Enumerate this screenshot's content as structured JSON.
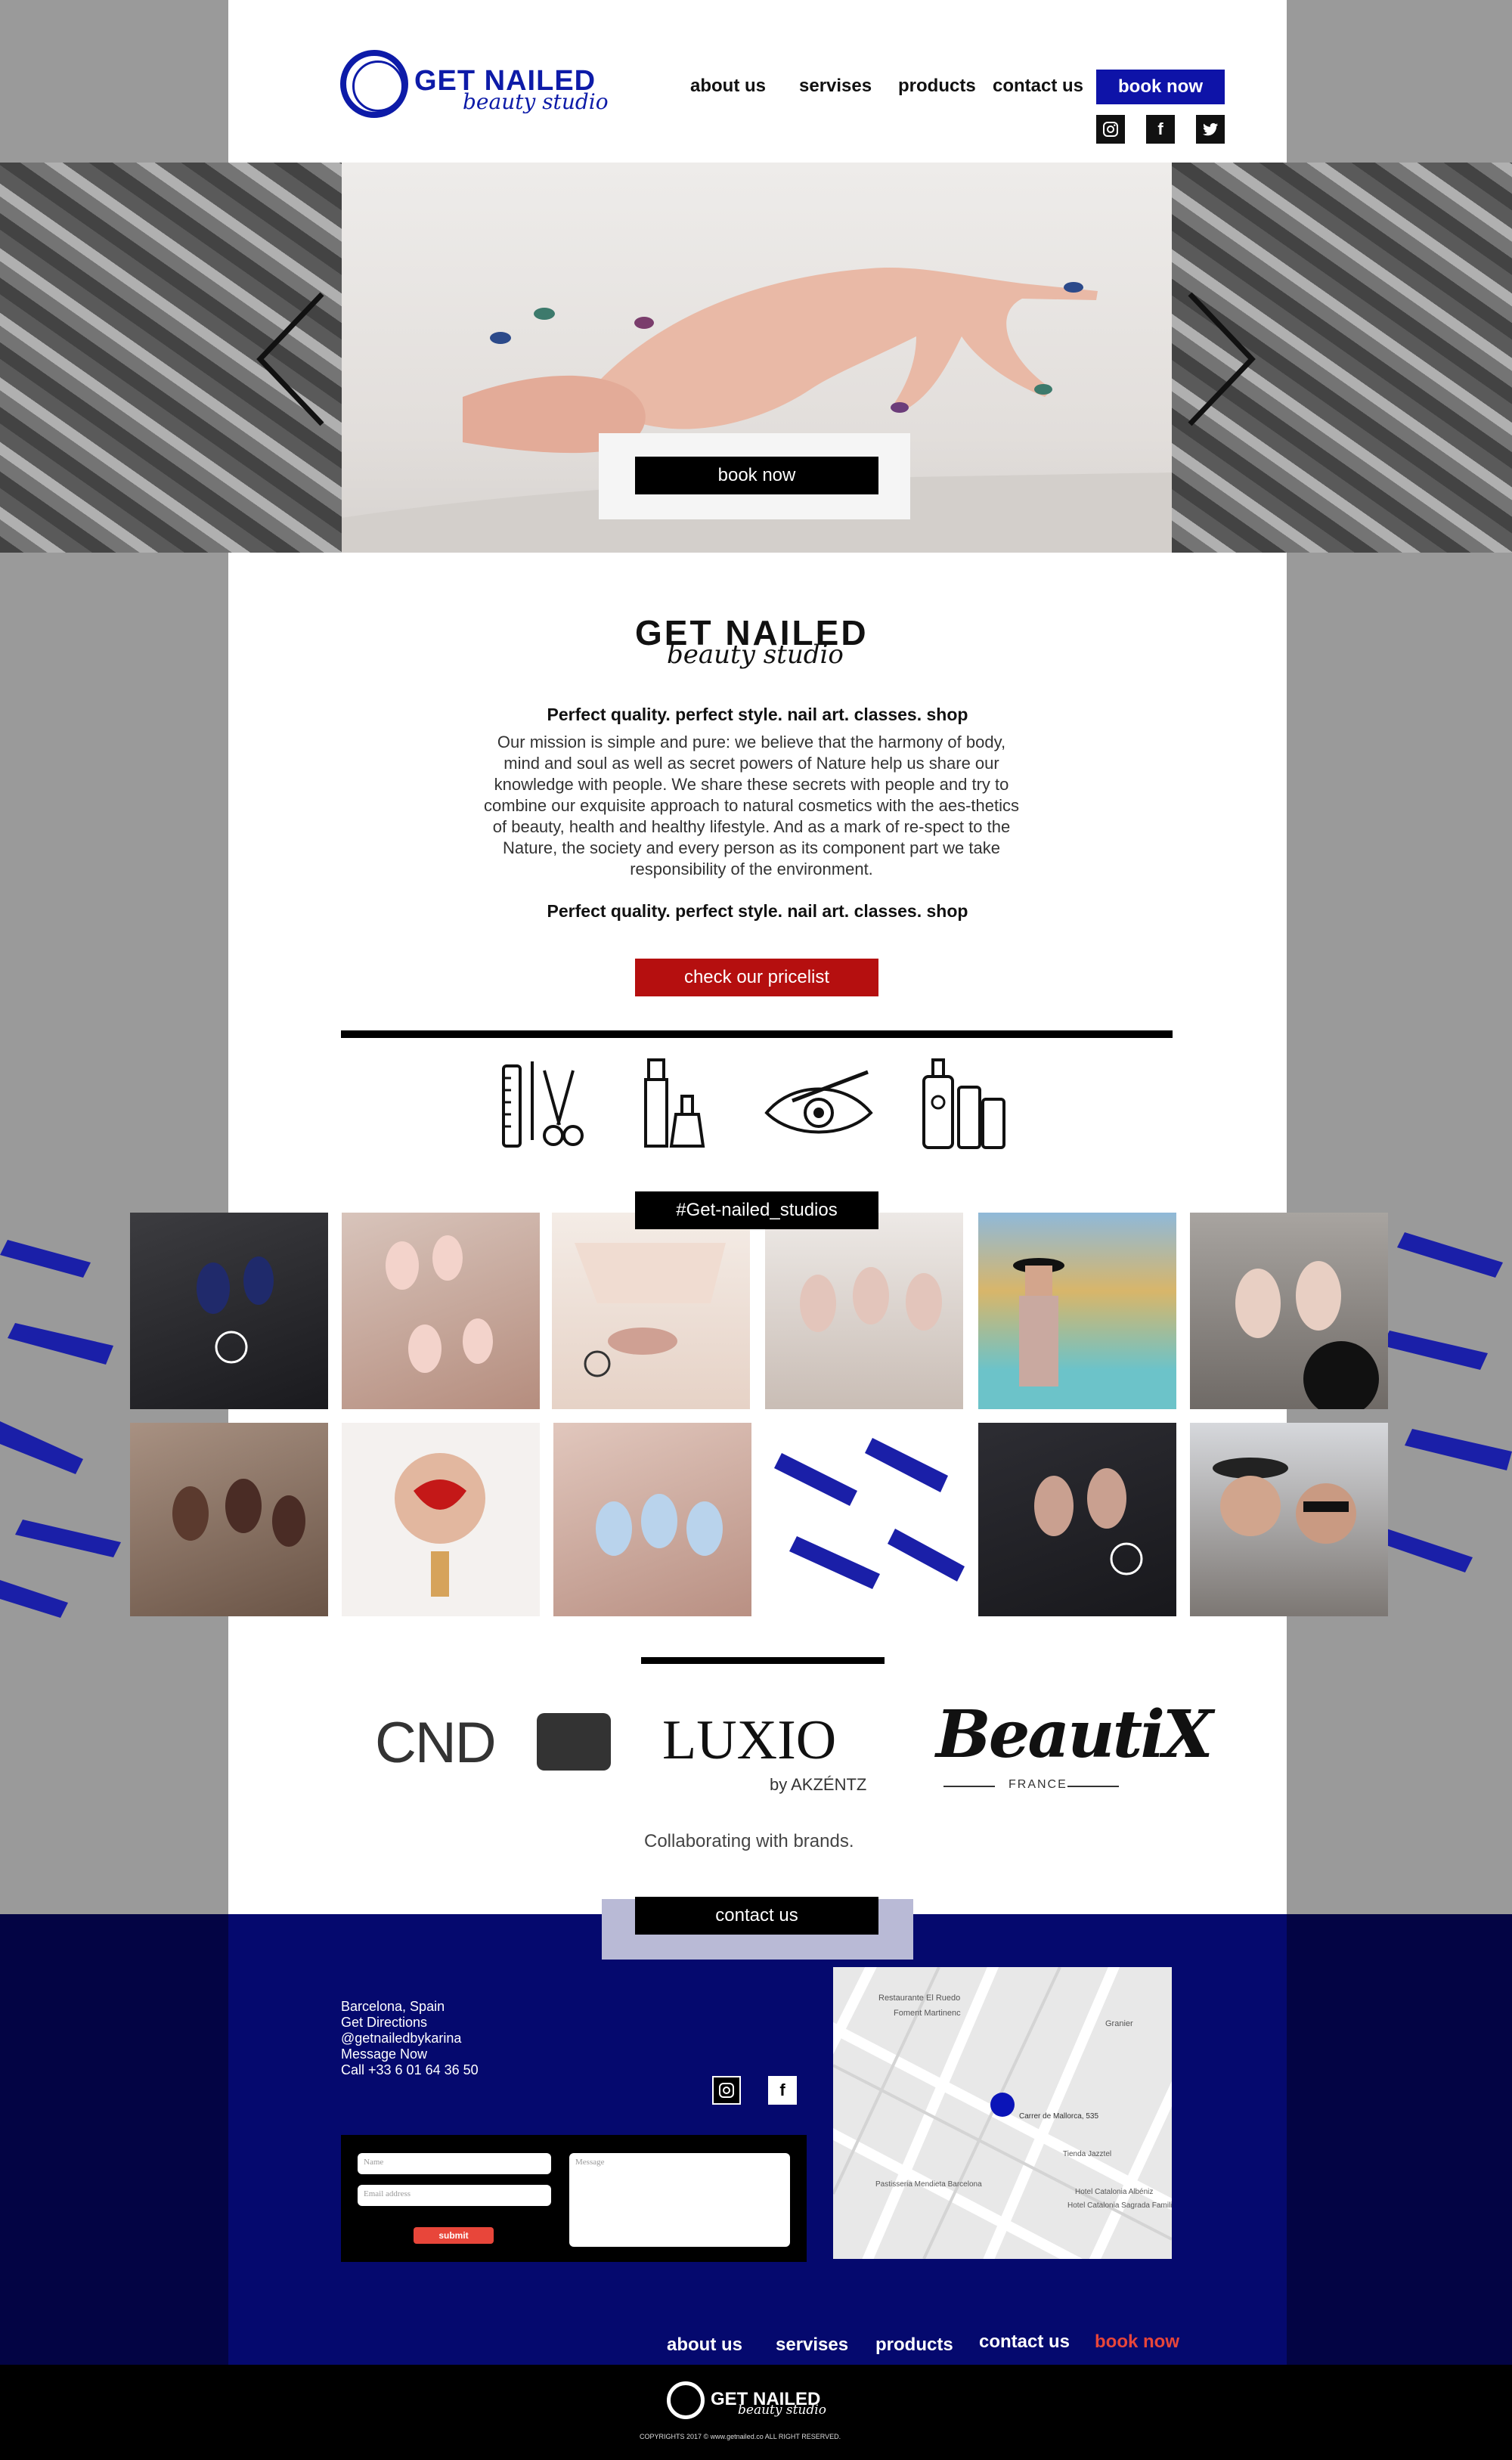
{
  "brand": {
    "name": "GET NAILED",
    "tagline": "beauty studio"
  },
  "nav": {
    "about": "about us",
    "services": "servises",
    "products": "products",
    "contact": "contact us",
    "book": "book now"
  },
  "social": {
    "instagram": "instagram-icon",
    "facebook": "f",
    "twitter": "twitter-icon"
  },
  "hero": {
    "book_button": "book now"
  },
  "about": {
    "tagline": "Perfect quality. perfect style. nail art. classes. shop",
    "mission": "Our mission is simple and pure: we believe that the harmony of body, mind and soul as well as secret powers of Nature help us share our knowledge with people. We share these secrets with people and try to combine our exquisite approach to natural cosmetics with the aes-thetics of beauty, health and healthy lifestyle. And as a mark of re-spect to the Nature, the society and every person as its component part we take responsibility of the environment.",
    "tagline2": "Perfect quality. perfect style. nail art. classes. shop",
    "pricelist_button": "check our pricelist"
  },
  "gallery": {
    "hashtag": "#Get-nailed_studios"
  },
  "brands": {
    "cnd": "CND",
    "luxio": "LUXIO",
    "luxio_sub": "by AKZÉNTZ",
    "beautix": "BeautiX",
    "beautix_sub": "FRANCE",
    "caption": "Collaborating with  brands."
  },
  "contact": {
    "button": "contact us",
    "city": "Barcelona, Spain",
    "directions": "Get Directions",
    "handle": "@getnailedbykarina",
    "message": "Message Now",
    "phone": "Call +33 6 01 64 36 50",
    "form_name": "Name",
    "form_email": "Email address",
    "form_message": "Message",
    "form_submit": "submit"
  },
  "map": {
    "labels": [
      "Restaurante El Ruedo",
      "Foment Martinenc",
      "Granier",
      "Carrer de Mallorca, 535",
      "Pastisseria Mendieta Barcelona",
      "Tienda Jazztel",
      "Hotel Catalonia Albéniz",
      "Hotel Catalonia Sagrada Familia"
    ]
  },
  "footer_nav": {
    "about": "about us",
    "services": "servises",
    "products": "products",
    "contact": "contact us",
    "book": "book now"
  },
  "copyright": "COPYRIGHTS 2017 © www.getnailed.co  ALL RIGHT RESERVED.",
  "colors": {
    "brand_blue": "#0d1ba8",
    "footer_blue": "#05096e",
    "accent_red": "#b50f0f",
    "book_red": "#e8463a"
  }
}
